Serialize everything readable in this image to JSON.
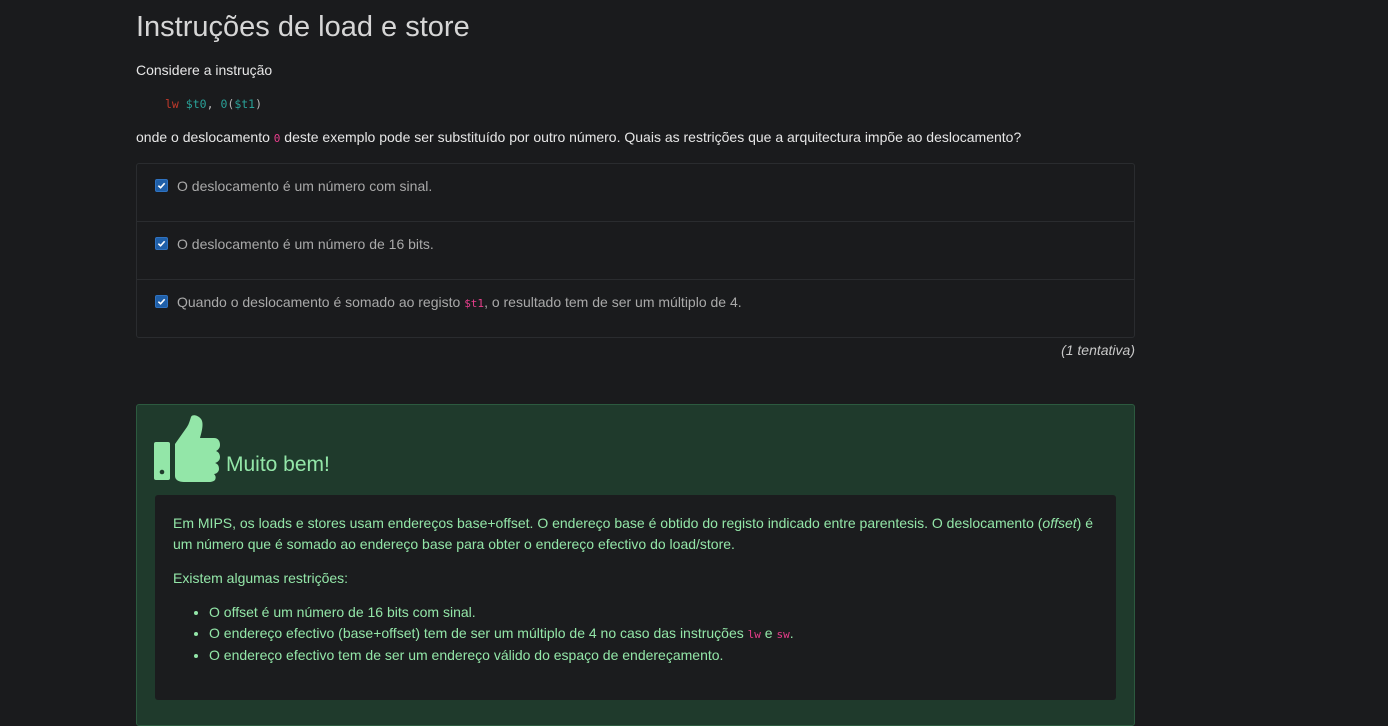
{
  "title": "Instruções de load e store",
  "intro": "Considere a instrução",
  "code": {
    "op": "lw",
    "reg1": "$t0",
    "comma": ",",
    "offset": "0",
    "open_paren": "(",
    "reg2": "$t1",
    "close_paren": ")"
  },
  "question": {
    "before": "onde o deslocamento ",
    "code": "0",
    "after": " deste exemplo pode ser substituído por outro número. Quais as restrições que a arquitectura impõe ao deslocamento?"
  },
  "options": [
    {
      "checked": true,
      "label": "O deslocamento é um número com sinal."
    },
    {
      "checked": true,
      "label": "O deslocamento é um número de 16 bits."
    },
    {
      "checked": true,
      "label_before": "Quando o deslocamento é somado ao registo ",
      "label_code": "$t1",
      "label_after": ", o resultado tem de ser um múltiplo de 4."
    }
  ],
  "attempts": "(1 tentativa)",
  "feedback": {
    "icon": "thumbs-up-icon",
    "title": "Muito bem!",
    "p1_before": "Em MIPS, os loads e stores usam endereços base+offset. O endereço base é obtido do registo indicado entre parentesis. O deslocamento (",
    "p1_em": "offset",
    "p1_after": ") é um número que é somado ao endereço base para obter o endereço efectivo do load/store.",
    "p2": "Existem algumas restrições:",
    "bullets": [
      {
        "text": "O offset é um número de 16 bits com sinal."
      },
      {
        "before": "O endereço efectivo (base+offset) tem de ser um múltiplo de 4 no caso das instruções ",
        "code1": "lw",
        "mid": " e ",
        "code2": "sw",
        "after": "."
      },
      {
        "text": "O endereço efectivo tem de ser um endereço válido do espaço de endereçamento."
      }
    ]
  },
  "colors": {
    "background": "#1a1b1d",
    "checkbox": "#1f5fa8",
    "feedback_bg": "#1f3a2c",
    "feedback_text": "#93e6a8",
    "code_accent": "#e83e8c"
  }
}
